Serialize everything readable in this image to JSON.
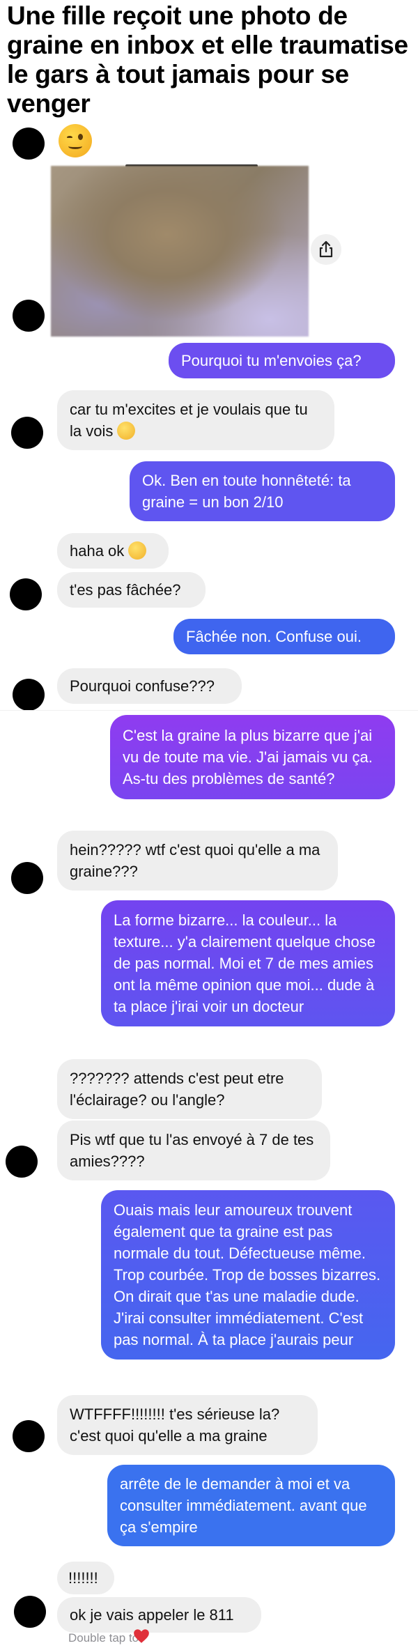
{
  "headline": "Une fille reçoit une photo de graine en inbox et elle traumatise le gars à tout jamais pour se venger",
  "colors": {
    "incoming_bg": "#eeeeee",
    "outgoing_top": "#8a3ff0",
    "outgoing_bottom": "#3a72ef"
  },
  "messages": [
    {
      "from": "them",
      "text": ""
    },
    {
      "from": "me",
      "text": "Pourquoi tu m'envoies ça?"
    },
    {
      "from": "them",
      "text": "car tu m'excites et je voulais que tu la vois"
    },
    {
      "from": "me",
      "text": "Ok. Ben en toute honnêteté: ta graine = un bon 2/10"
    },
    {
      "from": "them",
      "text": "haha ok"
    },
    {
      "from": "them",
      "text": "t'es pas fâchée?"
    },
    {
      "from": "me",
      "text": "Fâchée non. Confuse oui."
    },
    {
      "from": "them",
      "text": "Pourquoi confuse???"
    },
    {
      "from": "me",
      "text": "C'est la graine la plus bizarre que j'ai vu de toute ma vie. J'ai jamais vu ça. As-tu des problèmes de santé?"
    },
    {
      "from": "them",
      "text": "hein????? wtf c'est quoi qu'elle a ma graine???"
    },
    {
      "from": "me",
      "text": "La forme bizarre... la couleur... la texture... y'a clairement quelque chose de pas normal. Moi et 7 de mes amies ont la même opinion que moi... dude à ta place j'irai voir un docteur"
    },
    {
      "from": "them",
      "text": "??????? attends c'est peut etre l'éclairage? ou l'angle?"
    },
    {
      "from": "them",
      "text": "Pis wtf que tu l'as envoyé à 7 de tes amies????"
    },
    {
      "from": "me",
      "text": "Ouais mais leur amoureux trouvent également que ta graine est pas normale du tout. Défectueuse même. Trop courbée. Trop de bosses bizarres. On dirait que t'as une maladie dude. J'irai consulter immédiatement. C'est pas normal. À ta place j'aurais peur"
    },
    {
      "from": "them",
      "text": "WTFFFF!!!!!!!! t'es sérieuse la? c'est quoi qu'elle a ma graine"
    },
    {
      "from": "me",
      "text": "arrête de le demander à moi et va consulter immédiatement. avant que ça s'empire"
    },
    {
      "from": "them",
      "text": "!!!!!!!"
    },
    {
      "from": "them",
      "text": "ok je vais appeler le 811"
    }
  ],
  "footer_hint": "Double tap to",
  "icons": {
    "wink": "winking-face-emoji",
    "smile": "smiling-face-emoji",
    "sweat": "grinning-sweat-emoji",
    "share": "share-icon",
    "heart": "heart-emoji"
  }
}
